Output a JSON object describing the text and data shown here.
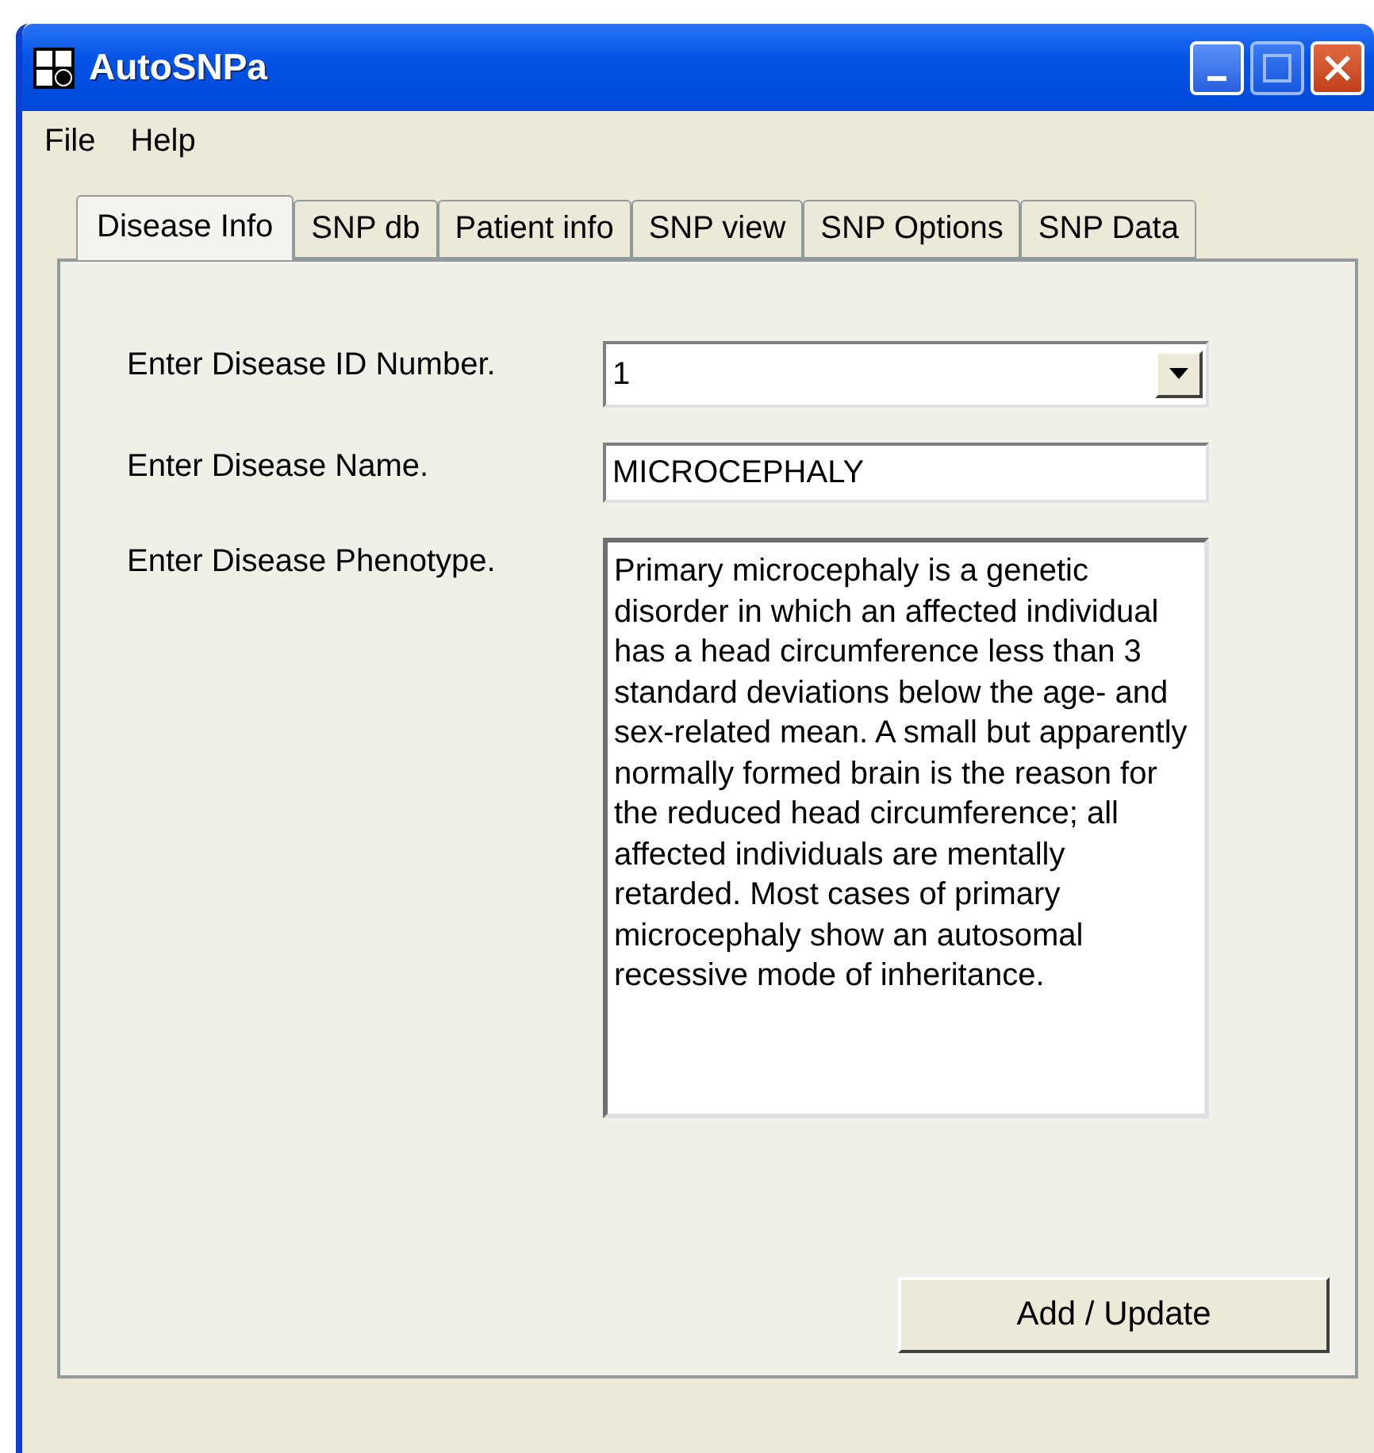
{
  "window": {
    "title": "AutoSNPa"
  },
  "menu": [
    "File",
    "Help"
  ],
  "tabs": [
    {
      "label": "Disease Info",
      "selected": true
    },
    {
      "label": "SNP db",
      "selected": false
    },
    {
      "label": "Patient info",
      "selected": false
    },
    {
      "label": "SNP view",
      "selected": false
    },
    {
      "label": "SNP Options",
      "selected": false
    },
    {
      "label": "SNP Data",
      "selected": false
    }
  ],
  "form": {
    "fields": [
      {
        "kind": "dropdown",
        "label": "Enter Disease ID Number.",
        "value": "1"
      },
      {
        "kind": "text",
        "label": "Enter Disease Name.",
        "value": "MICROCEPHALY"
      },
      {
        "kind": "multiline",
        "label": "Enter Disease Phenotype.",
        "value": "Primary microcephaly is a genetic disorder in which an affected individual has a head circumference less than 3 standard deviations below the age- and sex-related mean. A small but apparently normally formed brain is the reason for the reduced head circumference; all affected individuals are mentally retarded. Most cases of primary microcephaly show an autosomal recessive mode of inheritance."
      }
    ],
    "button": "Add / Update"
  }
}
